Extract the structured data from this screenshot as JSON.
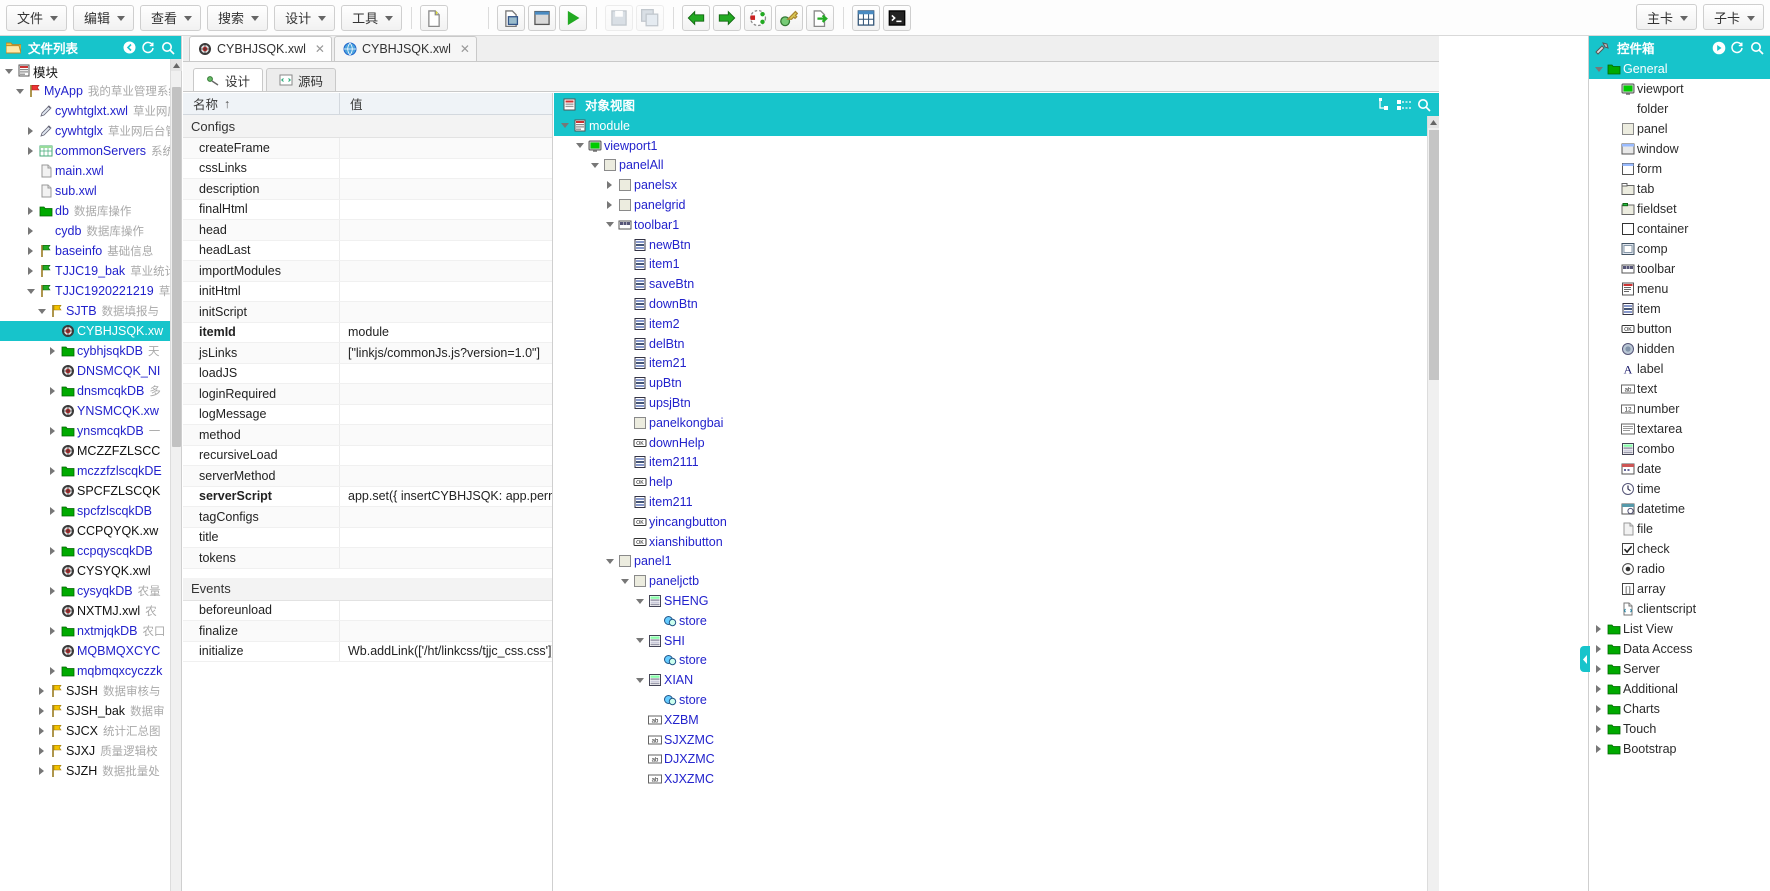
{
  "topbar": {
    "menus": [
      {
        "label": "文件"
      },
      {
        "label": "编辑"
      },
      {
        "label": "查看"
      },
      {
        "label": "搜索"
      },
      {
        "label": "设计"
      },
      {
        "label": "工具"
      }
    ],
    "icons": [
      {
        "name": "new-file-icon"
      },
      {
        "name": "blank-icon"
      },
      {
        "name": "open-file-icon"
      },
      {
        "name": "window-icon"
      },
      {
        "name": "run-icon"
      },
      {
        "name": "save-icon"
      },
      {
        "name": "save-all-icon"
      },
      {
        "name": "back-icon"
      },
      {
        "name": "forward-icon"
      },
      {
        "name": "debug-icon"
      },
      {
        "name": "key-icon"
      },
      {
        "name": "export-icon"
      },
      {
        "name": "table-icon"
      },
      {
        "name": "console-icon"
      }
    ],
    "right_menus": [
      {
        "label": "主卡"
      },
      {
        "label": "子卡"
      }
    ]
  },
  "filelist": {
    "title": "文件列表",
    "tools": [
      "back-icon",
      "refresh-icon",
      "search-icon"
    ],
    "tree": [
      {
        "indent": 0,
        "arrow": "open",
        "icon": "module-icon",
        "label": "模块",
        "label_color": "black",
        "desc": ""
      },
      {
        "indent": 1,
        "arrow": "open",
        "icon": "flag-red",
        "label": "MyApp",
        "desc": "我的草业管理系统"
      },
      {
        "indent": 2,
        "arrow": "none",
        "icon": "pen-icon",
        "label": "cywhtglxt.xwl",
        "desc": "草业网应"
      },
      {
        "indent": 2,
        "arrow": "closed",
        "icon": "pen-icon",
        "label": "cywhtglx",
        "desc": "草业网后台管"
      },
      {
        "indent": 2,
        "arrow": "closed",
        "icon": "grid-icon",
        "label": "commonServers",
        "desc": "系统"
      },
      {
        "indent": 2,
        "arrow": "none",
        "icon": "file-icon",
        "label": "main.xwl",
        "desc": ""
      },
      {
        "indent": 2,
        "arrow": "none",
        "icon": "file-icon",
        "label": "sub.xwl",
        "desc": ""
      },
      {
        "indent": 2,
        "arrow": "closed",
        "icon": "folder-green",
        "label": "db",
        "desc": "数据库操作"
      },
      {
        "indent": 2,
        "arrow": "closed",
        "icon": "none",
        "label": "cydb",
        "desc": "数据库操作"
      },
      {
        "indent": 2,
        "arrow": "closed",
        "icon": "flag-green",
        "label": "baseinfo",
        "desc": "基础信息"
      },
      {
        "indent": 2,
        "arrow": "closed",
        "icon": "flag-green",
        "label": "TJJC19_bak",
        "desc": "草业统计"
      },
      {
        "indent": 2,
        "arrow": "open",
        "icon": "flag-green",
        "label": "TJJC1920221219",
        "desc": "草"
      },
      {
        "indent": 3,
        "arrow": "open",
        "icon": "flag-yellow",
        "label": "SJTB",
        "desc": "数据填报与"
      },
      {
        "indent": 4,
        "arrow": "none",
        "icon": "bullseye",
        "label": "CYBHJSQK.xw",
        "desc": "",
        "selected": true
      },
      {
        "indent": 4,
        "arrow": "closed",
        "icon": "folder-green",
        "label": "cybhjsqkDB",
        "desc": "天"
      },
      {
        "indent": 4,
        "arrow": "none",
        "icon": "bullseye",
        "label": "DNSMCQK_NI",
        "desc": ""
      },
      {
        "indent": 4,
        "arrow": "closed",
        "icon": "folder-green",
        "label": "dnsmcqkDB",
        "desc": "多"
      },
      {
        "indent": 4,
        "arrow": "none",
        "icon": "bullseye",
        "label": "YNSMCQK.xw",
        "desc": ""
      },
      {
        "indent": 4,
        "arrow": "closed",
        "icon": "folder-green",
        "label": "ynsmcqkDB",
        "desc": "一"
      },
      {
        "indent": 4,
        "arrow": "none",
        "icon": "bullseye",
        "label": "MCZZFZLSCC",
        "desc": "",
        "label_color": "black"
      },
      {
        "indent": 4,
        "arrow": "closed",
        "icon": "folder-green",
        "label": "mczzfzlscqkDE",
        "desc": ""
      },
      {
        "indent": 4,
        "arrow": "none",
        "icon": "bullseye",
        "label": "SPCFZLSCQK",
        "desc": "",
        "label_color": "black"
      },
      {
        "indent": 4,
        "arrow": "closed",
        "icon": "folder-green",
        "label": "spcfzlscqkDB",
        "desc": ""
      },
      {
        "indent": 4,
        "arrow": "none",
        "icon": "bullseye",
        "label": "CCPQYQK.xw",
        "desc": "",
        "label_color": "black"
      },
      {
        "indent": 4,
        "arrow": "closed",
        "icon": "folder-green",
        "label": "ccpqyscqkDB",
        "desc": ""
      },
      {
        "indent": 4,
        "arrow": "none",
        "icon": "bullseye",
        "label": "CYSYQK.xwl",
        "desc": "",
        "label_color": "black"
      },
      {
        "indent": 4,
        "arrow": "closed",
        "icon": "folder-green",
        "label": "cysyqkDB",
        "desc": "农量"
      },
      {
        "indent": 4,
        "arrow": "none",
        "icon": "bullseye",
        "label": "NXTMJ.xwl",
        "desc": "农",
        "label_color": "black"
      },
      {
        "indent": 4,
        "arrow": "closed",
        "icon": "folder-green",
        "label": "nxtmjqkDB",
        "desc": "农口"
      },
      {
        "indent": 4,
        "arrow": "none",
        "icon": "bullseye",
        "label": "MQBMQXCYC",
        "desc": ""
      },
      {
        "indent": 4,
        "arrow": "closed",
        "icon": "folder-green",
        "label": "mqbmqxcyczzk",
        "desc": ""
      },
      {
        "indent": 3,
        "arrow": "closed",
        "icon": "flag-yellow",
        "label": "SJSH",
        "desc": "数据审核与",
        "label_color": "black"
      },
      {
        "indent": 3,
        "arrow": "closed",
        "icon": "flag-yellow",
        "label": "SJSH_bak",
        "desc": "数据审",
        "label_color": "black"
      },
      {
        "indent": 3,
        "arrow": "closed",
        "icon": "flag-yellow",
        "label": "SJCX",
        "desc": "统计汇总图",
        "label_color": "black"
      },
      {
        "indent": 3,
        "arrow": "closed",
        "icon": "flag-yellow",
        "label": "SJXJ",
        "desc": "质量逻辑校",
        "label_color": "black"
      },
      {
        "indent": 3,
        "arrow": "closed",
        "icon": "flag-yellow",
        "label": "SJZH",
        "desc": "数据批量处",
        "label_color": "black"
      }
    ]
  },
  "center": {
    "file_tabs": [
      {
        "label": "CYBHJSQK.xwl",
        "icon": "bullseye",
        "active": true,
        "closable": true
      },
      {
        "label": "CYBHJSQK.xwl",
        "icon": "globe",
        "active": false,
        "closable": true
      }
    ],
    "view_tabs": [
      {
        "label": "设计",
        "icon": "design-icon",
        "active": true
      },
      {
        "label": "源码",
        "icon": "source-icon",
        "active": false
      }
    ],
    "property_grid": {
      "col_name": "名称",
      "col_name_sort": "↑",
      "col_value": "值",
      "sections": [
        {
          "title": "Configs",
          "rows": [
            {
              "name": "createFrame",
              "value": ""
            },
            {
              "name": "cssLinks",
              "value": ""
            },
            {
              "name": "description",
              "value": ""
            },
            {
              "name": "finalHtml",
              "value": ""
            },
            {
              "name": "head",
              "value": ""
            },
            {
              "name": "headLast",
              "value": ""
            },
            {
              "name": "importModules",
              "value": ""
            },
            {
              "name": "initHtml",
              "value": ""
            },
            {
              "name": "initScript",
              "value": ""
            },
            {
              "name": "itemId",
              "value": "module",
              "bold": true
            },
            {
              "name": "jsLinks",
              "value": "[\"linkjs/commonJs.js?version=1.0\"]"
            },
            {
              "name": "loadJS",
              "value": ""
            },
            {
              "name": "loginRequired",
              "value": ""
            },
            {
              "name": "logMessage",
              "value": ""
            },
            {
              "name": "method",
              "value": ""
            },
            {
              "name": "recursiveLoad",
              "value": ""
            },
            {
              "name": "serverMethod",
              "value": ""
            },
            {
              "name": "serverScript",
              "value": "app.set({ insertCYBHJSQK: app.perm('...",
              "bold": true
            },
            {
              "name": "tagConfigs",
              "value": ""
            },
            {
              "name": "title",
              "value": ""
            },
            {
              "name": "tokens",
              "value": ""
            }
          ]
        },
        {
          "title": "Events",
          "rows": [
            {
              "name": "beforeunload",
              "value": ""
            },
            {
              "name": "finalize",
              "value": ""
            },
            {
              "name": "initialize",
              "value": "Wb.addLink(['/ht/linkcss/tjjc_css.css']); a..."
            }
          ]
        }
      ]
    },
    "object_view": {
      "title": "对象视图",
      "tools": [
        "collapse-icon",
        "expand-icon",
        "search-icon"
      ],
      "tree": [
        {
          "indent": 0,
          "arrow": "open",
          "icon": "module-icon",
          "label": "module",
          "selected": true
        },
        {
          "indent": 1,
          "arrow": "open",
          "icon": "viewport-icon",
          "label": "viewport1"
        },
        {
          "indent": 2,
          "arrow": "open",
          "icon": "panel-icon",
          "label": "panelAll"
        },
        {
          "indent": 3,
          "arrow": "closed",
          "icon": "panel-icon",
          "label": "panelsx"
        },
        {
          "indent": 3,
          "arrow": "closed",
          "icon": "panel-icon",
          "label": "panelgrid"
        },
        {
          "indent": 3,
          "arrow": "open",
          "icon": "toolbar-icon",
          "label": "toolbar1"
        },
        {
          "indent": 4,
          "arrow": "none",
          "icon": "item-icon",
          "label": "newBtn"
        },
        {
          "indent": 4,
          "arrow": "none",
          "icon": "item-icon",
          "label": "item1"
        },
        {
          "indent": 4,
          "arrow": "none",
          "icon": "item-icon",
          "label": "saveBtn"
        },
        {
          "indent": 4,
          "arrow": "none",
          "icon": "item-icon",
          "label": "downBtn"
        },
        {
          "indent": 4,
          "arrow": "none",
          "icon": "item-icon",
          "label": "item2"
        },
        {
          "indent": 4,
          "arrow": "none",
          "icon": "item-icon",
          "label": "delBtn"
        },
        {
          "indent": 4,
          "arrow": "none",
          "icon": "item-icon",
          "label": "item21"
        },
        {
          "indent": 4,
          "arrow": "none",
          "icon": "item-icon",
          "label": "upBtn"
        },
        {
          "indent": 4,
          "arrow": "none",
          "icon": "item-icon",
          "label": "upsjBtn"
        },
        {
          "indent": 4,
          "arrow": "none",
          "icon": "panel-icon",
          "label": "panelkongbai"
        },
        {
          "indent": 4,
          "arrow": "none",
          "icon": "button-icon",
          "label": "downHelp"
        },
        {
          "indent": 4,
          "arrow": "none",
          "icon": "item-icon",
          "label": "item2111"
        },
        {
          "indent": 4,
          "arrow": "none",
          "icon": "button-icon",
          "label": "help"
        },
        {
          "indent": 4,
          "arrow": "none",
          "icon": "item-icon",
          "label": "item211"
        },
        {
          "indent": 4,
          "arrow": "none",
          "icon": "button-icon",
          "label": "yincangbutton"
        },
        {
          "indent": 4,
          "arrow": "none",
          "icon": "button-icon",
          "label": "xianshibutton"
        },
        {
          "indent": 3,
          "arrow": "open",
          "icon": "panel-icon",
          "label": "panel1"
        },
        {
          "indent": 4,
          "arrow": "open",
          "icon": "panel-icon",
          "label": "paneljctb"
        },
        {
          "indent": 5,
          "arrow": "open",
          "icon": "combo-icon",
          "label": "SHENG"
        },
        {
          "indent": 6,
          "arrow": "none",
          "icon": "store-icon",
          "label": "store"
        },
        {
          "indent": 5,
          "arrow": "open",
          "icon": "combo-icon",
          "label": "SHI"
        },
        {
          "indent": 6,
          "arrow": "none",
          "icon": "store-icon",
          "label": "store"
        },
        {
          "indent": 5,
          "arrow": "open",
          "icon": "combo-icon",
          "label": "XIAN"
        },
        {
          "indent": 6,
          "arrow": "none",
          "icon": "store-icon",
          "label": "store"
        },
        {
          "indent": 5,
          "arrow": "none",
          "icon": "text-icon",
          "label": "XZBM"
        },
        {
          "indent": 5,
          "arrow": "none",
          "icon": "text-icon",
          "label": "SJXZMC"
        },
        {
          "indent": 5,
          "arrow": "none",
          "icon": "text-icon",
          "label": "DJXZMC"
        },
        {
          "indent": 5,
          "arrow": "none",
          "icon": "text-icon",
          "label": "XJXZMC"
        }
      ]
    }
  },
  "toolbox": {
    "title": "控件箱",
    "tools": [
      "play-icon",
      "refresh-icon",
      "search-icon"
    ],
    "tree": [
      {
        "indent": 0,
        "arrow": "open",
        "icon": "folder-green",
        "label": "General",
        "group": true
      },
      {
        "indent": 1,
        "arrow": "none",
        "icon": "viewport-icon",
        "label": "viewport"
      },
      {
        "indent": 1,
        "arrow": "none",
        "icon": "none",
        "label": "folder"
      },
      {
        "indent": 1,
        "arrow": "none",
        "icon": "panel-icon",
        "label": "panel"
      },
      {
        "indent": 1,
        "arrow": "none",
        "icon": "window-icon",
        "label": "window"
      },
      {
        "indent": 1,
        "arrow": "none",
        "icon": "form-icon",
        "label": "form"
      },
      {
        "indent": 1,
        "arrow": "none",
        "icon": "tab-icon",
        "label": "tab"
      },
      {
        "indent": 1,
        "arrow": "none",
        "icon": "fieldset-icon",
        "label": "fieldset"
      },
      {
        "indent": 1,
        "arrow": "none",
        "icon": "container-icon",
        "label": "container"
      },
      {
        "indent": 1,
        "arrow": "none",
        "icon": "comp-icon",
        "label": "comp"
      },
      {
        "indent": 1,
        "arrow": "none",
        "icon": "toolbar-icon",
        "label": "toolbar"
      },
      {
        "indent": 1,
        "arrow": "none",
        "icon": "menu-icon",
        "label": "menu"
      },
      {
        "indent": 1,
        "arrow": "none",
        "icon": "item-icon",
        "label": "item"
      },
      {
        "indent": 1,
        "arrow": "none",
        "icon": "button-icon",
        "label": "button"
      },
      {
        "indent": 1,
        "arrow": "none",
        "icon": "hidden-icon",
        "label": "hidden"
      },
      {
        "indent": 1,
        "arrow": "none",
        "icon": "label-icon",
        "label": "label"
      },
      {
        "indent": 1,
        "arrow": "none",
        "icon": "text-icon",
        "label": "text"
      },
      {
        "indent": 1,
        "arrow": "none",
        "icon": "number-icon",
        "label": "number"
      },
      {
        "indent": 1,
        "arrow": "none",
        "icon": "textarea-icon",
        "label": "textarea"
      },
      {
        "indent": 1,
        "arrow": "none",
        "icon": "combo-icon",
        "label": "combo"
      },
      {
        "indent": 1,
        "arrow": "none",
        "icon": "date-icon",
        "label": "date"
      },
      {
        "indent": 1,
        "arrow": "none",
        "icon": "time-icon",
        "label": "time"
      },
      {
        "indent": 1,
        "arrow": "none",
        "icon": "datetime-icon",
        "label": "datetime"
      },
      {
        "indent": 1,
        "arrow": "none",
        "icon": "file-icon",
        "label": "file"
      },
      {
        "indent": 1,
        "arrow": "none",
        "icon": "check-icon",
        "label": "check"
      },
      {
        "indent": 1,
        "arrow": "none",
        "icon": "radio-icon",
        "label": "radio"
      },
      {
        "indent": 1,
        "arrow": "none",
        "icon": "array-icon",
        "label": "array"
      },
      {
        "indent": 1,
        "arrow": "none",
        "icon": "script-icon",
        "label": "clientscript"
      },
      {
        "indent": 0,
        "arrow": "closed",
        "icon": "folder-green",
        "label": "List View"
      },
      {
        "indent": 0,
        "arrow": "closed",
        "icon": "folder-green",
        "label": "Data Access"
      },
      {
        "indent": 0,
        "arrow": "closed",
        "icon": "folder-green",
        "label": "Server"
      },
      {
        "indent": 0,
        "arrow": "closed",
        "icon": "folder-green",
        "label": "Additional"
      },
      {
        "indent": 0,
        "arrow": "closed",
        "icon": "folder-green",
        "label": "Charts"
      },
      {
        "indent": 0,
        "arrow": "closed",
        "icon": "folder-green",
        "label": "Touch"
      },
      {
        "indent": 0,
        "arrow": "closed",
        "icon": "folder-green",
        "label": "Bootstrap"
      }
    ]
  },
  "colors": {
    "accent": "#17c4cb",
    "tree_link": "#2222cc",
    "desc": "#a9a9a9"
  }
}
